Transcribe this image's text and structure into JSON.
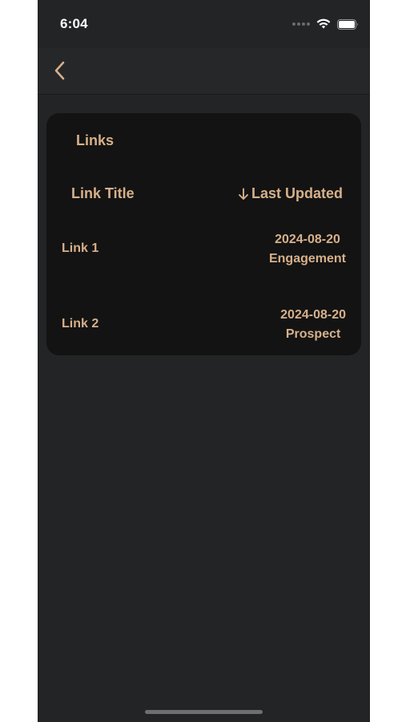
{
  "status_bar": {
    "time": "6:04"
  },
  "nav": {
    "back_icon": "chevron-left-icon"
  },
  "links_card": {
    "title": "Links",
    "columns": {
      "link_title": "Link Title",
      "last_updated": "Last Updated",
      "sort_icon": "arrow-down-icon"
    },
    "rows": [
      {
        "title": "Link 1",
        "date": "2024-08-20",
        "category": "Engagement"
      },
      {
        "title": "Link 2",
        "date": "2024-08-20",
        "category": "Prospect"
      }
    ]
  },
  "colors": {
    "accent": "#d6b08a",
    "background": "#232425",
    "card": "#131313"
  }
}
